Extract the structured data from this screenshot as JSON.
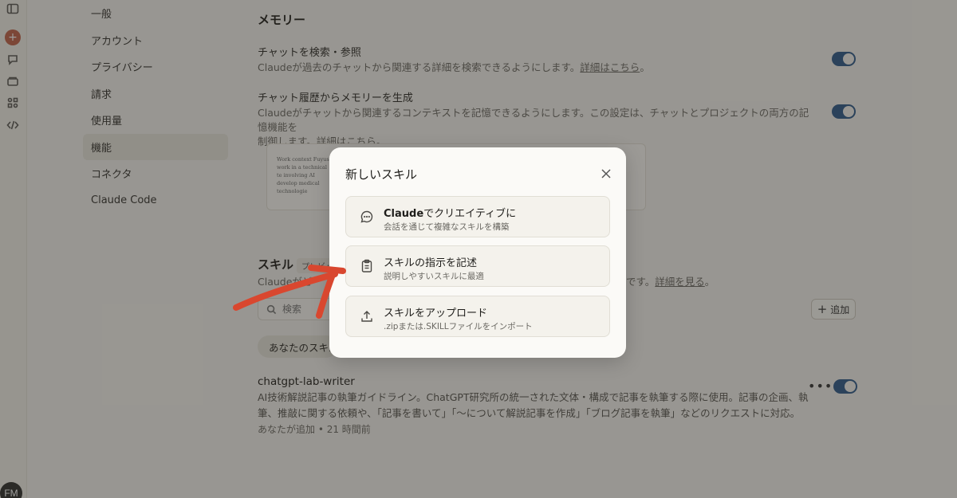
{
  "nav": {
    "items": [
      {
        "label": "一般"
      },
      {
        "label": "アカウント"
      },
      {
        "label": "プライバシー"
      },
      {
        "label": "請求"
      },
      {
        "label": "使用量"
      },
      {
        "label": "機能"
      },
      {
        "label": "コネクタ"
      },
      {
        "label": "Claude Code"
      }
    ],
    "active_index": 5
  },
  "user": {
    "initials": "FM"
  },
  "memory": {
    "title": "メモリー",
    "search": {
      "title": "チャットを検索・参照",
      "desc": "Claudeが過去のチャットから関連する詳細を検索できるようにします。",
      "link": "詳細はこちら",
      "suffix": "。",
      "enabled": true
    },
    "generate": {
      "title": "チャット履歴からメモリーを生成",
      "desc_line1": "Claudeがチャットから関連するコンテキストを記憶できるようにします。この設定は、チャットとプロジェクトの両方の記憶機能を",
      "desc_line2": "制御します。",
      "link": "詳細はこちら",
      "suffix": "。",
      "enabled": true
    },
    "preview_text": "Work context Fuyush work in a technical te involving AI develop medical technologie"
  },
  "skills": {
    "title": "スキル",
    "badge": "プレビュー",
    "desc_prefix": "Claudeがど",
    "desc_suffix": "です。",
    "link": "詳細を見る",
    "link_suffix": "。",
    "search_placeholder": "検索",
    "add_label": "追加",
    "filter_label": "あなたのスキル",
    "item": {
      "name": "chatgpt-lab-writer",
      "desc": "AI技術解説記事の執筆ガイドライン。ChatGPT研究所の統一された文体・構成で記事を執筆する際に使用。記事の企画、執筆、推敲に関する依頼や、「記事を書いて」「〜について解説記事を作成」「ブログ記事を執筆」などのリクエストに対応。",
      "meta": "あなたが追加 • 21 時間前",
      "enabled": true
    }
  },
  "modal": {
    "title": "新しいスキル",
    "options": [
      {
        "title_bold": "Claude",
        "title_rest": "でクリエイティブに",
        "subtitle": "会話を通じて複雑なスキルを構築",
        "icon": "chat-bubble-icon"
      },
      {
        "title_bold": "",
        "title_rest": "スキルの指示を記述",
        "subtitle": "説明しやすいスキルに最適",
        "icon": "clipboard-icon"
      },
      {
        "title_bold": "",
        "title_rest": "スキルをアップロード",
        "subtitle": ".zipまたは.SKILLファイルをインポート",
        "icon": "upload-icon"
      }
    ]
  },
  "colors": {
    "accent": "#c1634a",
    "toggle_on": "#2e5a8a",
    "arrow": "#d9472f"
  }
}
